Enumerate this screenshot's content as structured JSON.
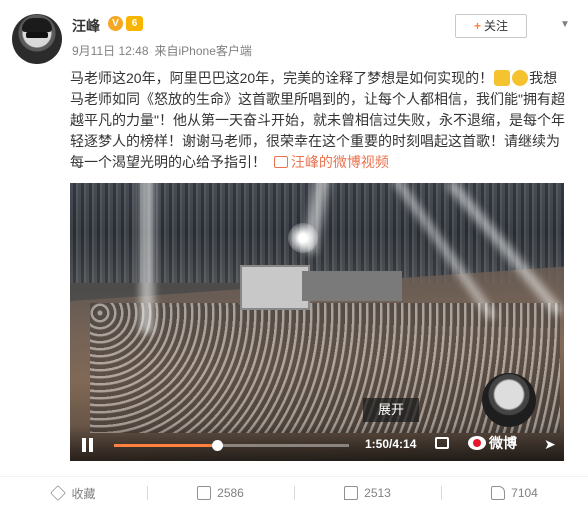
{
  "user": {
    "name": "汪峰",
    "verified_icon": "verified-v-icon",
    "level_icon": "vip-level-icon"
  },
  "post": {
    "date": "9月11日 12:48",
    "source_prefix": "来自",
    "source": "iPhone客户端",
    "follow_label": "关注",
    "text_part1": "马老师这20年，阿里巴巴这20年，完美的诠释了梦想是如何实现的！",
    "text_part2": "我想马老师如同《怒放的生命》这首歌里所唱到的，让每个人都相信，我们能\"拥有超越平凡的力量\"！他从第一天奋斗开始，就未曾相信过失败，永不退缩，是每个年轻逐梦人的榜样！谢谢马老师，很荣幸在这个重要的时刻唱起这首歌！请继续为每一个渴望光明的心给予指引！",
    "video_link_label": "汪峰的微博视频"
  },
  "video": {
    "expand_label": "展开",
    "time_readout": "1:50/4:14",
    "progress_fraction": 0.4382,
    "brand_label": "微博"
  },
  "actions": {
    "favorite_label": "收藏",
    "repost_count": "2586",
    "comment_count": "2513",
    "like_count": "7104"
  },
  "colors": {
    "accent": "#eb7350",
    "progress": "#ff8140",
    "weibo_red": "#e6162d"
  }
}
